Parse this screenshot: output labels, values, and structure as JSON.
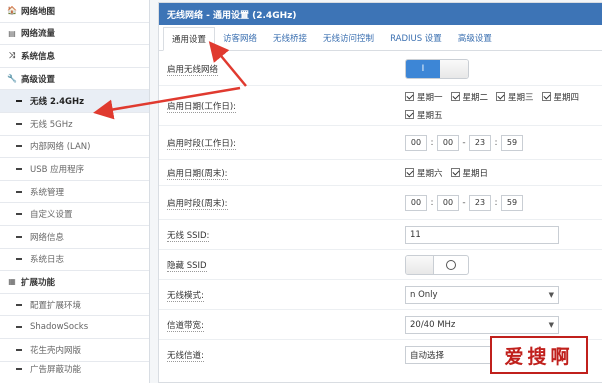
{
  "sidebar": {
    "items": [
      {
        "label": "网络地图",
        "icon": "home-icon",
        "glyph": "🏠",
        "type": "section"
      },
      {
        "label": "网络流量",
        "icon": "chart-icon",
        "glyph": "▤",
        "type": "section"
      },
      {
        "label": "系统信息",
        "icon": "shuffle-icon",
        "glyph": "⤨",
        "type": "section"
      },
      {
        "label": "高级设置",
        "icon": "wrench-icon",
        "glyph": "🔧",
        "type": "section"
      },
      {
        "label": "无线 2.4GHz",
        "type": "sub",
        "active": true
      },
      {
        "label": "无线 5GHz",
        "type": "sub"
      },
      {
        "label": "内部网络 (LAN)",
        "type": "sub"
      },
      {
        "label": "USB 应用程序",
        "type": "sub"
      },
      {
        "label": "系统管理",
        "type": "sub"
      },
      {
        "label": "自定义设置",
        "type": "sub"
      },
      {
        "label": "网络信息",
        "type": "sub"
      },
      {
        "label": "系统日志",
        "type": "sub"
      },
      {
        "label": "扩展功能",
        "icon": "grid-icon",
        "glyph": "▦",
        "type": "section"
      },
      {
        "label": "配置扩展环境",
        "type": "sub"
      },
      {
        "label": "ShadowSocks",
        "type": "sub"
      },
      {
        "label": "花生壳内网版",
        "type": "sub"
      },
      {
        "label": "广告屏蔽功能",
        "type": "sub"
      }
    ]
  },
  "panel": {
    "title": "无线网络 - 通用设置 (2.4GHz)",
    "tabs": [
      "通用设置",
      "访客网络",
      "无线桥接",
      "无线访问控制",
      "RADIUS 设置",
      "高级设置"
    ]
  },
  "form": {
    "enable_wireless": {
      "label": "启用无线网络",
      "state": "I"
    },
    "workday_dates": {
      "label": "启用日期(工作日):",
      "days": [
        "星期一",
        "星期二",
        "星期三",
        "星期四",
        "星期五"
      ]
    },
    "workday_time": {
      "label": "启用时段(工作日):",
      "values": [
        "00",
        "00",
        "23",
        "59"
      ]
    },
    "weekend_dates": {
      "label": "启用日期(周末):",
      "days": [
        "星期六",
        "星期日"
      ]
    },
    "weekend_time": {
      "label": "启用时段(周末):",
      "values": [
        "00",
        "00",
        "23",
        "59"
      ]
    },
    "ssid": {
      "label": "无线 SSID:",
      "value": "11"
    },
    "hide_ssid": {
      "label": "隐藏 SSID"
    },
    "mode": {
      "label": "无线模式:",
      "value": "n Only"
    },
    "bandwidth": {
      "label": "信道带宽:",
      "value": "20/40 MHz"
    },
    "channel": {
      "label": "无线信道:",
      "value": "自动选择"
    }
  },
  "watermark": "爱搜啊",
  "colors": {
    "accent": "#3d74b6",
    "toggle_on": "#3d86d6",
    "arrow": "#e03a2f",
    "watermark": "#c0201c"
  }
}
